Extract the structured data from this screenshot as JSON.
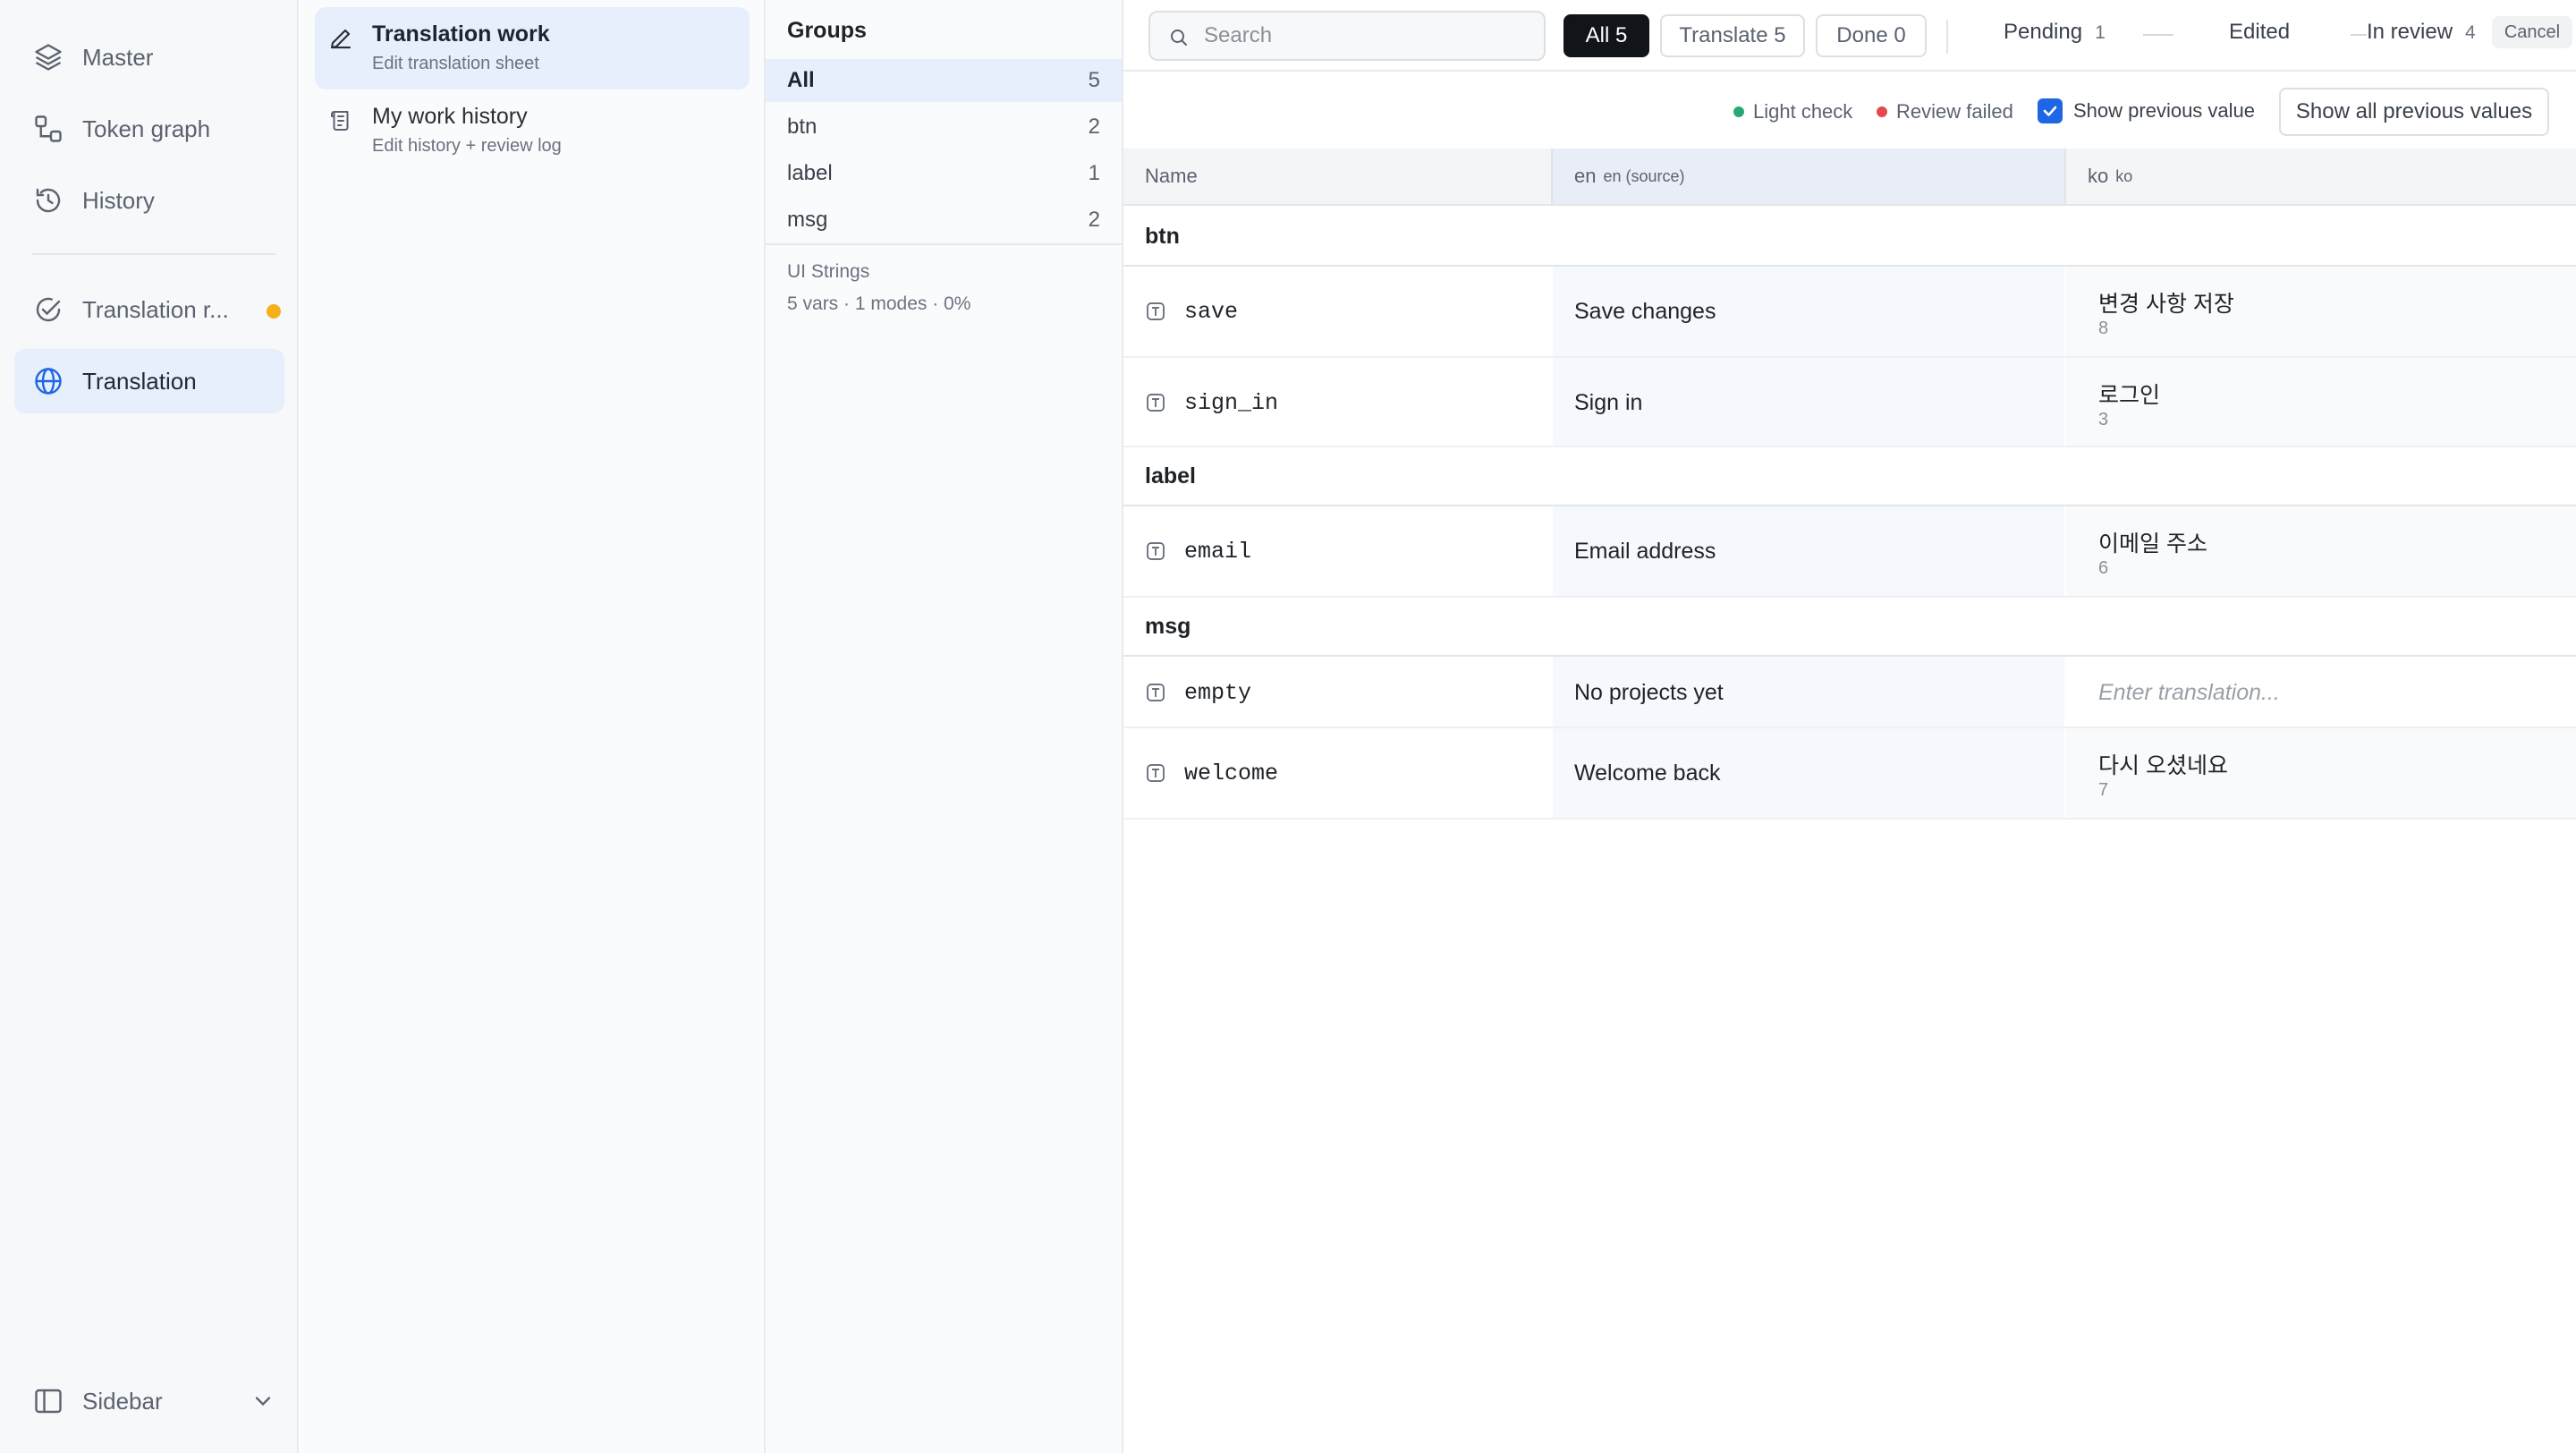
{
  "sidebar": {
    "items": [
      {
        "label": "Master",
        "icon": "layers-icon"
      },
      {
        "label": "Token graph",
        "icon": "graph-icon"
      },
      {
        "label": "History",
        "icon": "history-icon"
      },
      {
        "label": "Translation r...",
        "icon": "check-circle-icon"
      },
      {
        "label": "Translation",
        "icon": "globe-icon"
      }
    ],
    "footer_label": "Sidebar",
    "accent": "#f5b01a"
  },
  "work": {
    "items": [
      {
        "title": "Translation work",
        "subtitle": "Edit translation sheet",
        "icon": "pencil-icon"
      },
      {
        "title": "My work history",
        "subtitle": "Edit history + review log",
        "icon": "scroll-icon"
      }
    ]
  },
  "groups": {
    "title": "Groups",
    "items": [
      {
        "name": "All",
        "count": "5"
      },
      {
        "name": "btn",
        "count": "2"
      },
      {
        "name": "label",
        "count": "1"
      },
      {
        "name": "msg",
        "count": "2"
      }
    ],
    "collection_name": "UI Strings",
    "collection_stats": "5 vars · 1 modes · 0%"
  },
  "toolbar": {
    "search_placeholder": "Search",
    "filters": [
      {
        "label": "All 5"
      },
      {
        "label": "Translate 5"
      },
      {
        "label": "Done 0"
      }
    ],
    "stages": [
      {
        "label": "Pending",
        "count": "1"
      },
      {
        "label": "Edited",
        "count": ""
      },
      {
        "label": "In review",
        "count": "4"
      }
    ],
    "cancel_label": "Cancel"
  },
  "options": {
    "light_check": "Light check",
    "review_failed": "Review failed",
    "show_previous": "Show previous value",
    "show_all_previous": "Show all previous values",
    "colors": {
      "light_check": "#2aa775",
      "review_failed": "#e5484d",
      "checkbox": "#1f66e5"
    }
  },
  "table": {
    "headers": {
      "name": "Name",
      "source": "en",
      "source_sub": "en (source)",
      "target": "ko",
      "target_sub": "ko"
    },
    "target_placeholder": "Enter translation...",
    "groups": [
      {
        "name": "btn",
        "rows": [
          {
            "key": "save",
            "source": "Save changes",
            "target": "변경 사항 저장",
            "length": "8"
          },
          {
            "key": "sign_in",
            "source": "Sign in",
            "target": "로그인",
            "length": "3"
          }
        ]
      },
      {
        "name": "label",
        "rows": [
          {
            "key": "email",
            "source": "Email address",
            "target": "이메일 주소",
            "length": "6"
          }
        ]
      },
      {
        "name": "msg",
        "rows": [
          {
            "key": "empty",
            "source": "No projects yet",
            "target": "",
            "length": ""
          },
          {
            "key": "welcome",
            "source": "Welcome back",
            "target": "다시 오셨네요",
            "length": "7"
          }
        ]
      }
    ]
  }
}
